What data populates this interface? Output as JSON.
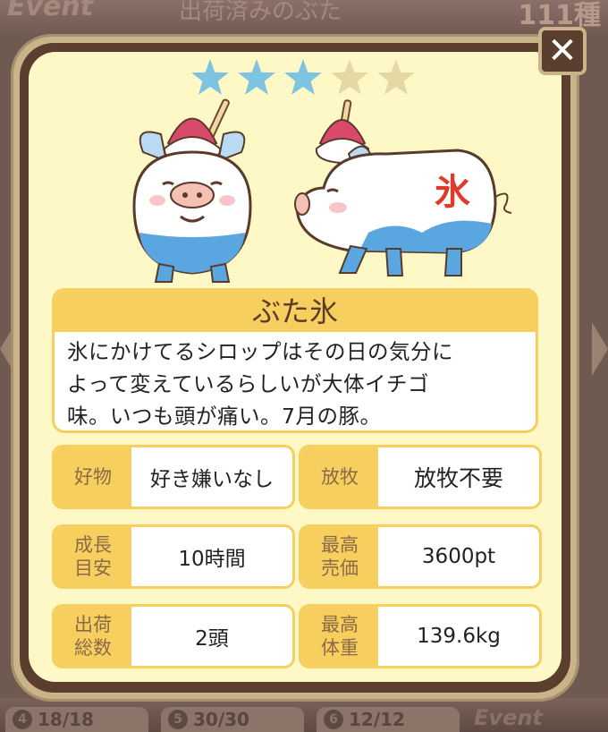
{
  "background": {
    "event_label": "Event",
    "title": "出荷済みのぶた",
    "count": "111種",
    "slots": [
      {
        "num": "4",
        "value": "18/18"
      },
      {
        "num": "5",
        "value": "30/30"
      },
      {
        "num": "6",
        "value": "12/12"
      }
    ]
  },
  "popup": {
    "close_label": "✕",
    "rating": {
      "filled": 3,
      "total": 5,
      "filled_color": "#7ec3df",
      "empty_color": "#e6d8a4"
    },
    "pig_mark": "氷",
    "name": "ぶた氷",
    "description_lines": [
      "氷にかけてるシロップはその日の気分に",
      "よって変えているらしいが大体イチゴ",
      "味。いつも頭が痛い。7月の豚。"
    ],
    "stats": {
      "favorite": {
        "label": "好物",
        "value": "好き嫌いなし"
      },
      "grazing": {
        "label": "放牧",
        "value": "放牧不要"
      },
      "growth": {
        "label": "成長\n目安",
        "label_1": "成長",
        "label_2": "目安",
        "value": "10時間"
      },
      "max_price": {
        "label": "最高\n売価",
        "label_1": "最高",
        "label_2": "売価",
        "value": "3600pt"
      },
      "shipped": {
        "label": "出荷\n総数",
        "label_1": "出荷",
        "label_2": "総数",
        "value": "2頭"
      },
      "max_weight": {
        "label": "最高\n体重",
        "label_1": "最高",
        "label_2": "体重",
        "value": "139.6kg"
      }
    }
  }
}
